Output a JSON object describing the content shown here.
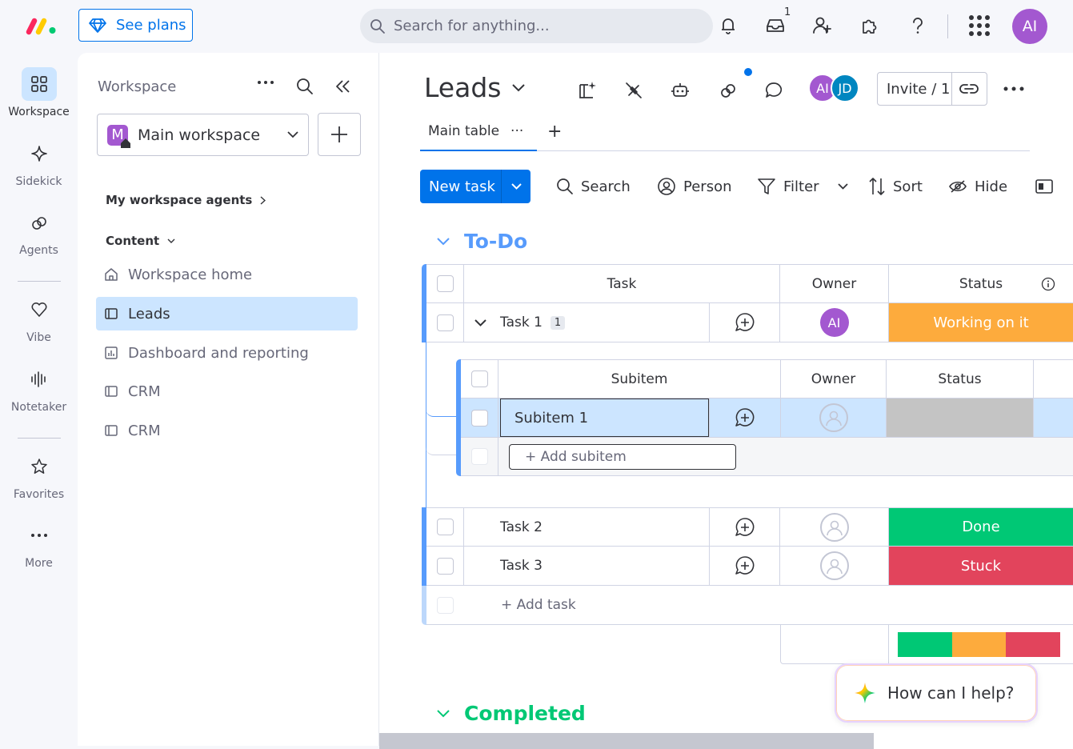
{
  "topbar": {
    "see_plans": "See plans",
    "search_placeholder": "Search for anything...",
    "inbox_count": "1",
    "user_initials": "AI",
    "icons": [
      "bell-icon",
      "inbox-icon",
      "invite-user-icon",
      "apps-puzzle-icon",
      "help-icon",
      "app-grid-icon"
    ]
  },
  "rail": {
    "items": [
      {
        "label": "Workspace",
        "icon": "workspace-grid-icon"
      },
      {
        "label": "Sidekick",
        "icon": "sparkle-icon"
      },
      {
        "label": "Agents",
        "icon": "agents-icon"
      },
      {
        "label": "Vibe",
        "icon": "heart-icon"
      },
      {
        "label": "Notetaker",
        "icon": "waveform-icon"
      },
      {
        "label": "Favorites",
        "icon": "star-icon"
      },
      {
        "label": "More",
        "icon": "more-dots-icon"
      }
    ]
  },
  "workspace": {
    "title": "Workspace",
    "selected": "Main workspace",
    "selected_initial": "M",
    "agents_label": "My workspace agents",
    "content_label": "Content",
    "items": [
      {
        "label": "Workspace home",
        "icon": "home-icon"
      },
      {
        "label": "Leads",
        "icon": "board-icon"
      },
      {
        "label": "Dashboard and reporting",
        "icon": "dashboard-icon"
      },
      {
        "label": "CRM",
        "icon": "board-icon"
      },
      {
        "label": "CRM",
        "icon": "board-icon"
      }
    ]
  },
  "board": {
    "title": "Leads",
    "avatars": [
      "AI",
      "JD"
    ],
    "invite": "Invite / 1",
    "tab_main": "Main table",
    "tab_dots": "···",
    "tab_add": "+",
    "new_task": "New task",
    "tools": {
      "search": "Search",
      "person": "Person",
      "filter": "Filter",
      "sort": "Sort",
      "hide": "Hide"
    },
    "group_todo": {
      "name": "To-Do",
      "columns": {
        "task": "Task",
        "owner": "Owner",
        "status": "Status"
      },
      "task1": {
        "name": "Task 1",
        "subcount": "1",
        "owner": "AI",
        "status": "Working on it"
      },
      "subitems": {
        "columns": {
          "name": "Subitem",
          "owner": "Owner",
          "status": "Status"
        },
        "row": "Subitem 1",
        "add": "+ Add subitem"
      },
      "task2": {
        "name": "Task 2",
        "status": "Done"
      },
      "task3": {
        "name": "Task 3",
        "status": "Stuck"
      },
      "add_task": "+ Add task"
    },
    "group_completed": {
      "name": "Completed"
    }
  },
  "colors": {
    "accent": "#0073ea",
    "working": "#fdab3d",
    "done": "#00c875",
    "stuck": "#e2445c",
    "todo_group": "#579bfc",
    "completed_group": "#00c875"
  },
  "help": {
    "text": "How can I help?"
  }
}
